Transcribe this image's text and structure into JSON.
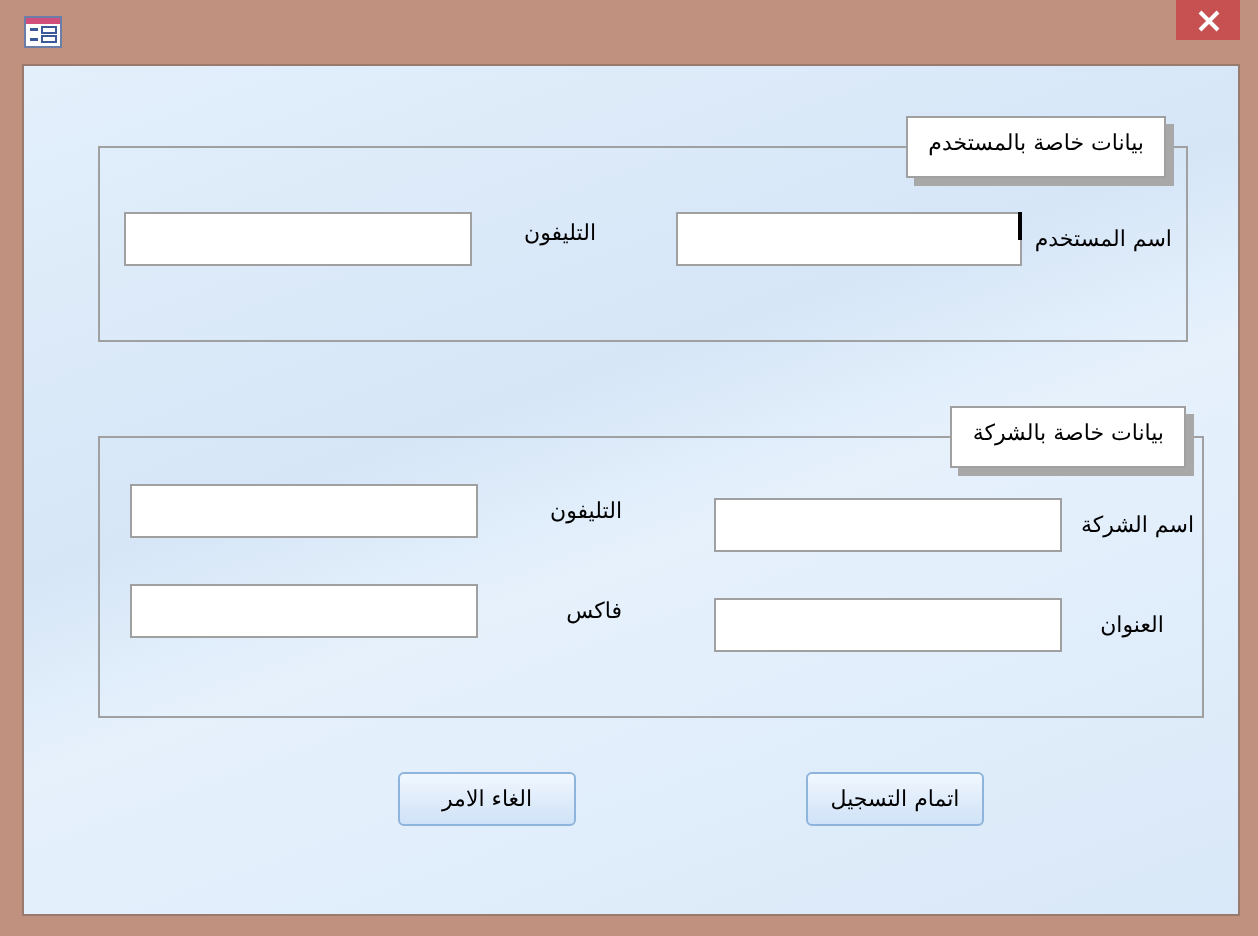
{
  "groups": [
    {
      "legend": "بيانات خاصة بالمستخدم",
      "rows": [
        {
          "fields": [
            {
              "label": "اسم المستخدم",
              "focused": true
            },
            {
              "label": "التليفون",
              "focused": false
            }
          ]
        }
      ]
    },
    {
      "legend": "بيانات خاصة بالشركة",
      "rows": [
        {
          "fields": [
            {
              "label": "اسم الشركة",
              "focused": false
            },
            {
              "label": "التليفون",
              "focused": false
            }
          ]
        },
        {
          "fields": [
            {
              "label": "العنوان",
              "focused": false
            },
            {
              "label": "فاكس",
              "focused": false
            }
          ]
        }
      ]
    }
  ],
  "buttons": [
    {
      "label": "اتمام التسجيل"
    },
    {
      "label": "الغاء الامر"
    }
  ]
}
